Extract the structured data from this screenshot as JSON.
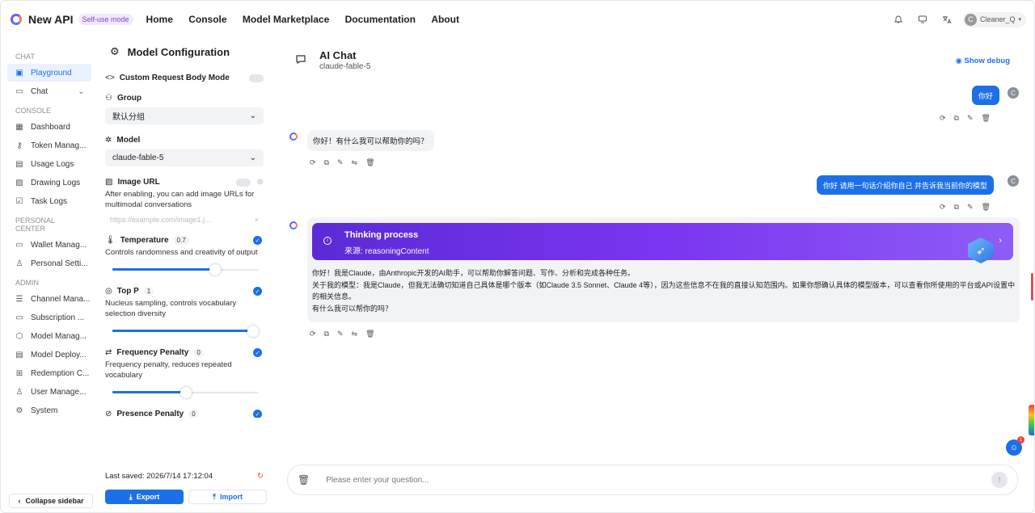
{
  "header": {
    "brand": "New API",
    "mode_badge": "Self-use mode",
    "nav": [
      "Home",
      "Console",
      "Model Marketplace",
      "Documentation",
      "About"
    ],
    "user": "Cleaner_Q",
    "user_initial": "C"
  },
  "sidebar": {
    "sections": [
      {
        "title": "CHAT",
        "items": [
          {
            "label": "Playground",
            "icon": "playground-icon",
            "active": true
          },
          {
            "label": "Chat",
            "icon": "chat-icon",
            "chevron": true
          }
        ]
      },
      {
        "title": "CONSOLE",
        "items": [
          {
            "label": "Dashboard",
            "icon": "dashboard-icon"
          },
          {
            "label": "Token Manag...",
            "icon": "key-icon"
          },
          {
            "label": "Usage Logs",
            "icon": "logs-icon"
          },
          {
            "label": "Drawing Logs",
            "icon": "image-icon"
          },
          {
            "label": "Task Logs",
            "icon": "task-icon"
          }
        ]
      },
      {
        "title": "PERSONAL CENTER",
        "items": [
          {
            "label": "Wallet Manag...",
            "icon": "wallet-icon"
          },
          {
            "label": "Personal Setti...",
            "icon": "user-icon"
          }
        ]
      },
      {
        "title": "ADMIN",
        "items": [
          {
            "label": "Channel Mana...",
            "icon": "channel-icon"
          },
          {
            "label": "Subscription ...",
            "icon": "subscription-icon"
          },
          {
            "label": "Model Manag...",
            "icon": "model-icon"
          },
          {
            "label": "Model Deploy...",
            "icon": "server-icon"
          },
          {
            "label": "Redemption C...",
            "icon": "gift-icon"
          },
          {
            "label": "User Manage...",
            "icon": "users-icon"
          },
          {
            "label": "System",
            "icon": "settings-icon"
          }
        ]
      }
    ],
    "collapse_label": "Collapse sidebar"
  },
  "config": {
    "title": "Model Configuration",
    "custom_body": "Custom Request Body Mode",
    "group_label": "Group",
    "group_value": "默认分组",
    "model_label": "Model",
    "model_value": "claude-fable-5",
    "image_url_label": "Image URL",
    "image_url_desc": "After enabling, you can add image URLs for multimodal conversations",
    "image_url_placeholder": "https://example.com/image1.j...",
    "temperature": {
      "label": "Temperature",
      "value": "0.7",
      "desc": "Controls randomness and creativity of output",
      "level": 0.7
    },
    "top_p": {
      "label": "Top P",
      "value": "1",
      "desc": "Nucleus sampling, controls vocabulary selection diversity",
      "level": 1.0
    },
    "frequency": {
      "label": "Frequency Penalty",
      "value": "0",
      "desc": "Frequency penalty, reduces repeated vocabulary",
      "level": 0.5
    },
    "presence": {
      "label": "Presence Penalty",
      "value": "0"
    },
    "last_saved": "Last saved: 2026/7/14 17:12:04",
    "export_label": "Export",
    "import_label": "Import"
  },
  "chat": {
    "title": "AI Chat",
    "subtitle": "claude-fable-5",
    "debug_label": "Show debug",
    "messages": {
      "u1": "你好",
      "a1": "你好！有什么我可以帮助你的吗？",
      "u2": "你好 请用一句话介绍你自己 并告诉我当前你的模型",
      "thinking_title": "Thinking process",
      "thinking_source": "来源: reasoningContent",
      "a2_lines": [
        "你好！我是Claude，由Anthropic开发的AI助手，可以帮助你解答问题、写作、分析和完成各种任务。",
        "关于我的模型：我是Claude，但我无法确切知道自己具体是哪个版本（如Claude 3.5 Sonnet、Claude 4等），因为这些信息不在我的直接认知范围内。如果你想确认具体的模型版本，可以查看你所使用的平台或API设置中的相关信息。",
        "有什么我可以帮你的吗？"
      ]
    },
    "input_placeholder": "Please enter your question...",
    "notification_count": "1"
  },
  "colors": {
    "accent": "#1d6fe8",
    "thinking_gradient_start": "#5b2ad6",
    "thinking_gradient_end": "#8e5cf6"
  }
}
